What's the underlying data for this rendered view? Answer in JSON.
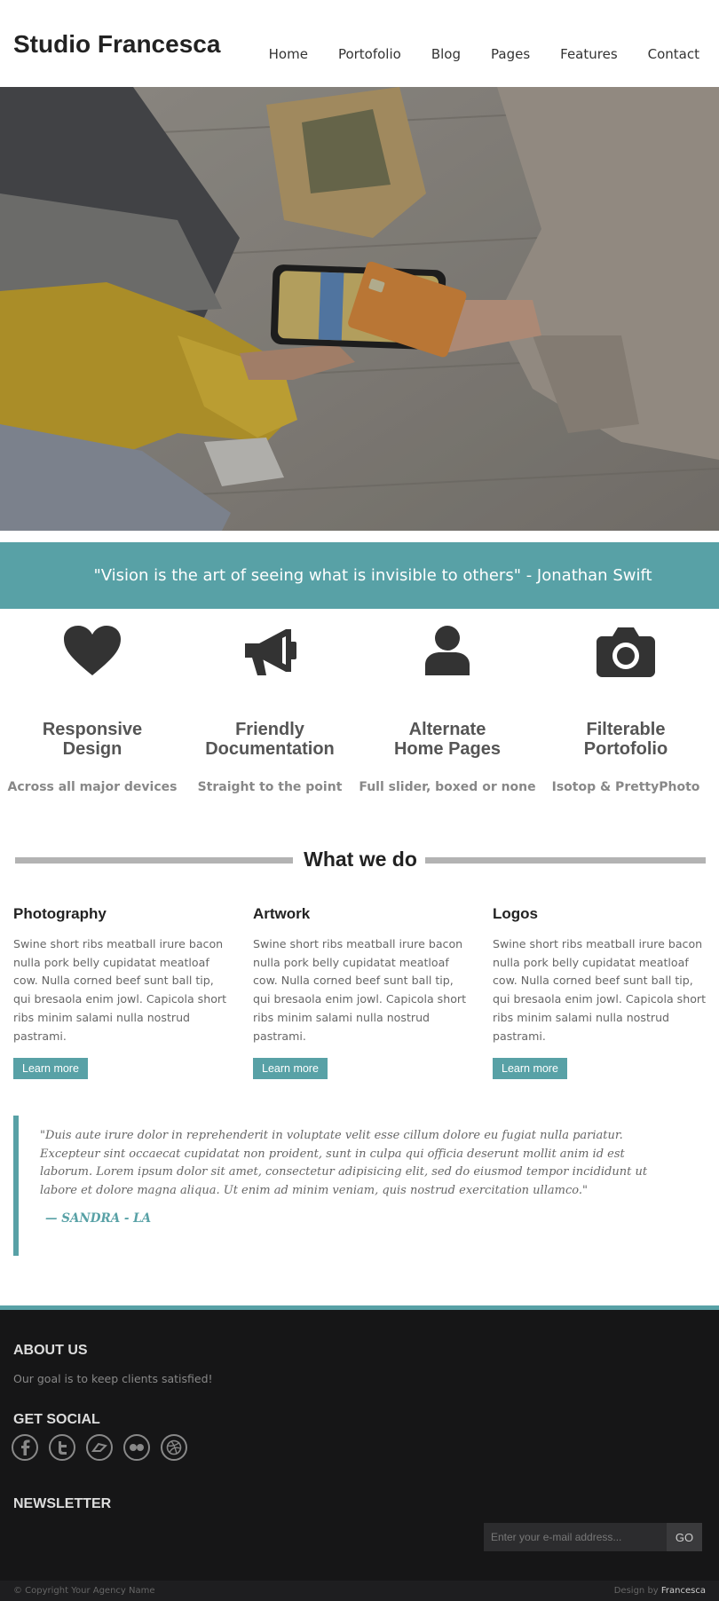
{
  "header": {
    "logo": "Studio Francesca",
    "nav": [
      "Home",
      "Portofolio",
      "Blog",
      "Pages",
      "Features",
      "Contact"
    ]
  },
  "hero": {
    "image": "photo of two people making a card payment on a phone"
  },
  "quote_band": {
    "text": "\"Vision is the art of seeing what is invisible to others\" - Jonathan Swift"
  },
  "features": [
    {
      "icon": "heart-icon",
      "title_line1": "Responsive",
      "title_line2": "Design",
      "subtitle": "Across all major devices"
    },
    {
      "icon": "megaphone-icon",
      "title_line1": "Friendly",
      "title_line2": "Documentation",
      "subtitle": "Straight to the point"
    },
    {
      "icon": "user-icon",
      "title_line1": "Alternate",
      "title_line2": "Home Pages",
      "subtitle": "Full slider, boxed or none"
    },
    {
      "icon": "camera-icon",
      "title_line1": "Filterable",
      "title_line2": "Portofolio",
      "subtitle": "Isotop & PrettyPhoto"
    }
  ],
  "what_we_do": {
    "title": "What we do",
    "services": [
      {
        "title": "Photography",
        "text": "Swine short ribs meatball irure bacon nulla pork belly cupidatat meatloaf cow. Nulla corned beef sunt ball tip, qui bresaola enim jowl. Capicola short ribs minim salami nulla nostrud pastrami.",
        "button": "Learn more"
      },
      {
        "title": "Artwork",
        "text": "Swine short ribs meatball irure bacon nulla pork belly cupidatat meatloaf cow. Nulla corned beef sunt ball tip, qui bresaola enim jowl. Capicola short ribs minim salami nulla nostrud pastrami.",
        "button": "Learn more"
      },
      {
        "title": "Logos",
        "text": "Swine short ribs meatball irure bacon nulla pork belly cupidatat meatloaf cow. Nulla corned beef sunt ball tip, qui bresaola enim jowl. Capicola short ribs minim salami nulla nostrud pastrami.",
        "button": "Learn more"
      }
    ]
  },
  "testimonial": {
    "quote": "\"Duis aute irure dolor in reprehenderit in voluptate velit esse cillum dolore eu fugiat nulla pariatur. Excepteur sint occaecat cupidatat non proident, sunt in culpa qui officia deserunt mollit anim id est laborum. Lorem ipsum dolor sit amet, consectetur adipisicing elit, sed do eiusmod tempor incididunt ut labore et dolore magna aliqua. Ut enim ad minim veniam, quis nostrud exercitation ullamco.\"",
    "author": "— SANDRA - LA"
  },
  "footer": {
    "about_title": "ABOUT US",
    "about_text": "Our goal is to keep clients satisfied!",
    "social_title": "GET SOCIAL",
    "social_icons": [
      "facebook-icon",
      "twitter-icon",
      "delicious-icon",
      "flickr-icon",
      "dribbble-icon"
    ],
    "newsletter_title": "NEWSLETTER",
    "newsletter_placeholder": "Enter your e-mail address...",
    "newsletter_button": "GO",
    "copyright": "© Copyright Your Agency Name",
    "design_by_label": "Design by",
    "design_by_name": "Francesca"
  },
  "colors": {
    "accent": "#58a1a6",
    "footer_bg": "#161617",
    "text_dark": "#222222"
  }
}
